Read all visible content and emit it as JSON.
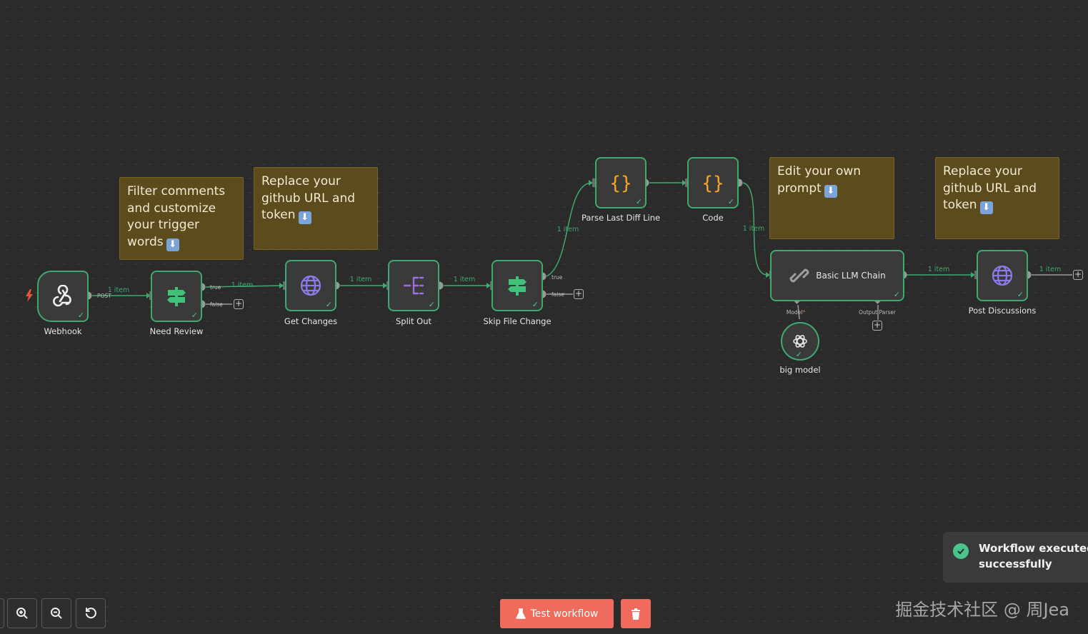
{
  "colors": {
    "canvas_bg": "#2b2b2b",
    "node_border": "#3fa970",
    "sticky_bg": "#5c4b1c",
    "accent_red": "#f06b5b",
    "success": "#4cc38a"
  },
  "stickies": [
    {
      "lines": [
        "Filter comments",
        "and customize",
        "your trigger",
        "words"
      ],
      "emoji": "⬇"
    },
    {
      "lines": [
        "Replace your",
        "github URL and",
        "token"
      ],
      "emoji": "⬇"
    },
    {
      "lines": [
        "Edit your own",
        "prompt"
      ],
      "emoji": "⬇"
    },
    {
      "lines": [
        "Replace your",
        "github URL and",
        "token"
      ],
      "emoji": "⬇"
    }
  ],
  "nodes": {
    "webhook": {
      "label": "Webhook",
      "port": "POST",
      "icon": "webhook-icon"
    },
    "need_review": {
      "label": "Need Review",
      "true_port": "true",
      "false_port": "false",
      "icon": "signpost-icon"
    },
    "get_changes": {
      "label": "Get Changes",
      "icon": "globe-icon"
    },
    "split_out": {
      "label": "Split Out",
      "icon": "split-icon"
    },
    "skip_file_change": {
      "label": "Skip File Change",
      "true_port": "true",
      "false_port": "false",
      "icon": "signpost-icon"
    },
    "parse_last_diff_line": {
      "label": "Parse Last Diff Line",
      "icon": "code-braces-icon"
    },
    "code": {
      "label": "Code",
      "icon": "code-braces-icon"
    },
    "basic_llm_chain": {
      "label": "Basic LLM Chain",
      "model_port": "Model",
      "required_mark": "*",
      "output_parser_port": "Output Parser",
      "icon": "link-icon"
    },
    "big_model": {
      "label": "big model",
      "icon": "openai-icon"
    },
    "post_discussions": {
      "label": "Post Discussions",
      "icon": "globe-icon"
    }
  },
  "edge_labels": {
    "webhook_to_review": "1 item",
    "review_to_get": "1 item",
    "get_to_split": "1 item",
    "split_to_skip": "1 item",
    "skip_to_parse": "1 item",
    "code_to_chain": "1 item",
    "chain_to_post": "1 item",
    "post_out": "1 item"
  },
  "toolbar": {
    "zoom_in": "zoom-in-icon",
    "zoom_out": "zoom-out-icon",
    "reset": "reset-icon"
  },
  "actions": {
    "test_workflow_label": "Test workflow",
    "delete": "trash-icon"
  },
  "toast": {
    "line1": "Workflow executed",
    "line2": "successfully"
  },
  "watermark": "掘金技术社区 @ 周Jea"
}
